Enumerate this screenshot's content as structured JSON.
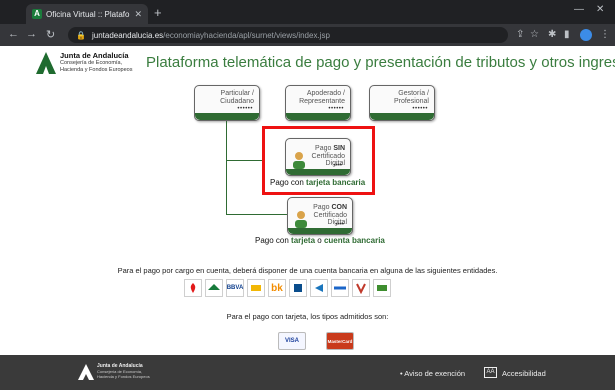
{
  "browser": {
    "tab_title": "Oficina Virtual :: Plataforma de T...",
    "tab_favicon": "A",
    "url_host": "juntadeandalucia.es",
    "url_path": "/economiayhacienda/apl/surnet/views/index.jsp"
  },
  "header": {
    "brand_line1": "Junta de Andalucía",
    "brand_line2": "Consejería de Economía,",
    "brand_line3": "Hacienda y Fondos Europeos",
    "title": "Plataforma telemática de pago y presentación de tributos y otros ingresos"
  },
  "profiles": [
    {
      "line1": "Particular /",
      "line2": "Ciudadano",
      "dots": "••••••"
    },
    {
      "line1": "Apoderado /",
      "line2": "Representante",
      "dots": "••••••"
    },
    {
      "line1": "Gestoría /",
      "line2": "Profesional",
      "dots": "••••••"
    }
  ],
  "pago_sin": {
    "l1a": "Pago ",
    "l1b": "SIN",
    "l2": "Certificado",
    "l3": "Digital",
    "dots": "••••",
    "caption_a": "Pago con ",
    "caption_b": "tarjeta bancaria"
  },
  "pago_con": {
    "l1a": "Pago ",
    "l1b": "CON",
    "l2": "Certificado",
    "l3": "Digital",
    "dots": "••••",
    "caption_a": "Pago con ",
    "caption_b": "tarjeta",
    "caption_c": " o ",
    "caption_d": "cuenta bancaria"
  },
  "info_banks": "Para el pago por cargo en cuenta, deberá disponer de una cuenta bancaria en alguna de las siguientes entidades.",
  "banks": [
    "santander-logo",
    "unicaja-logo",
    "bbva-logo",
    "cajarural-logo",
    "bankinter-logo",
    "ibercaja-logo",
    "caixabank-logo",
    "abanca-logo",
    "cajamar-logo",
    "cajasur-logo"
  ],
  "banks_text": {
    "bbva": "BBVA",
    "bk": "bk"
  },
  "info_cards": "Para el pago con tarjeta, los tipos admitidos son:",
  "cards": {
    "visa": "VISA",
    "mastercard": "MasterCard"
  },
  "footer": {
    "brand_line1": "Junta de Andalucía",
    "brand_line2": "Consejería de Economía,",
    "brand_line3": "Hacienda y Fondos Europeos",
    "aviso": "• Aviso de exención",
    "accesibilidad": "Accesibilidad",
    "acc_icon_text": "AA"
  },
  "colors": {
    "green": "#2f6b33",
    "title_green": "#3a7d3f",
    "highlight": "#ee1111",
    "footer": "#3a3a3a"
  }
}
